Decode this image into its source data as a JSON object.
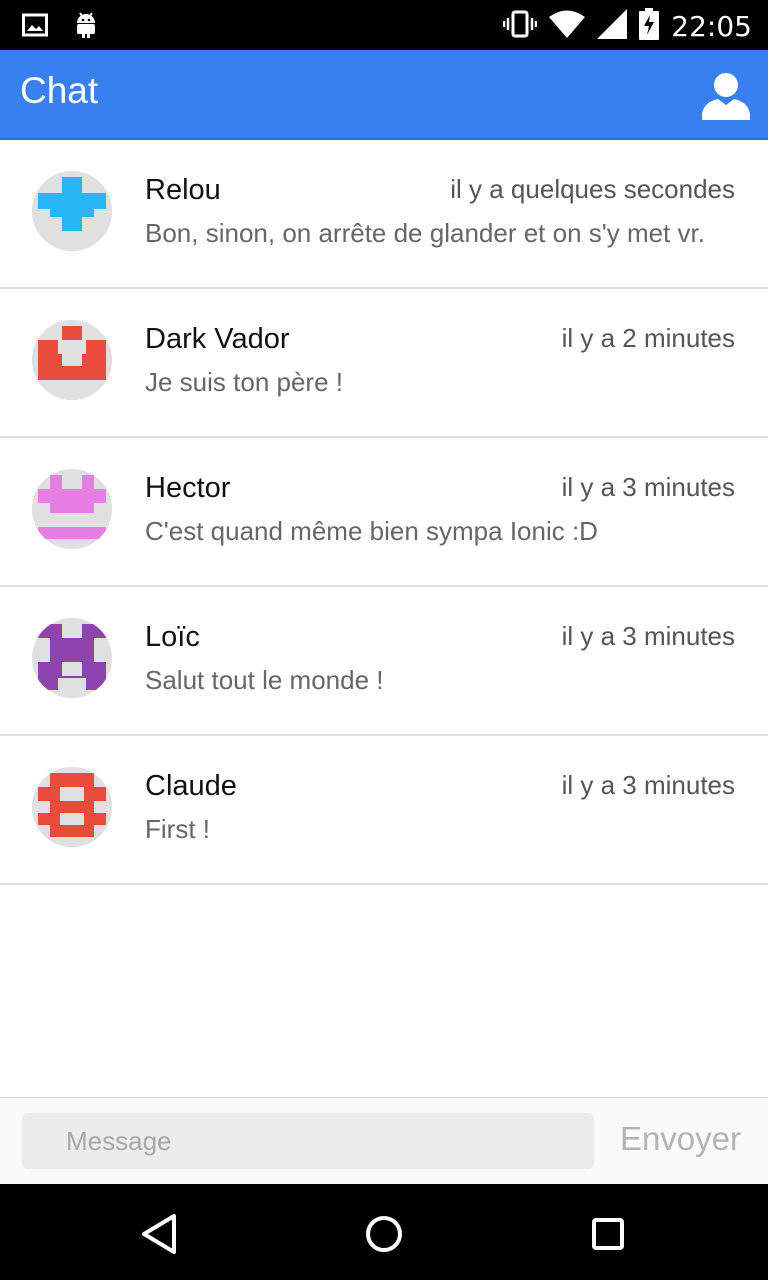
{
  "status_bar": {
    "time": "22:05",
    "icons": [
      "image-icon",
      "android-icon",
      "vibrate-icon",
      "wifi-icon",
      "signal-icon",
      "battery-charging-icon"
    ]
  },
  "header": {
    "title": "Chat",
    "action_icon": "user-icon",
    "color": "#3880f0"
  },
  "messages": [
    {
      "name": "Relou",
      "time": "il y a quelques secondes",
      "text": "Bon, sinon, on arrête de glander et on s'y met vr.",
      "avatar_color": "#29b6f6"
    },
    {
      "name": "Dark Vador",
      "time": "il y a 2 minutes",
      "text": "Je suis ton père !",
      "avatar_color": "#e74c3c"
    },
    {
      "name": "Hector",
      "time": "il y a 3 minutes",
      "text": "C'est quand même bien sympa Ionic :D",
      "avatar_color": "#e57ee3"
    },
    {
      "name": "Loïc",
      "time": "il y a 3 minutes",
      "text": "Salut tout le monde !",
      "avatar_color": "#8e44ad"
    },
    {
      "name": "Claude",
      "time": "il y a 3 minutes",
      "text": "First !",
      "avatar_color": "#e74c3c"
    }
  ],
  "composer": {
    "placeholder": "Message",
    "value": "",
    "send_label": "Envoyer"
  },
  "nav_bar": {
    "icons": [
      "back-icon",
      "home-icon",
      "recents-icon"
    ]
  }
}
